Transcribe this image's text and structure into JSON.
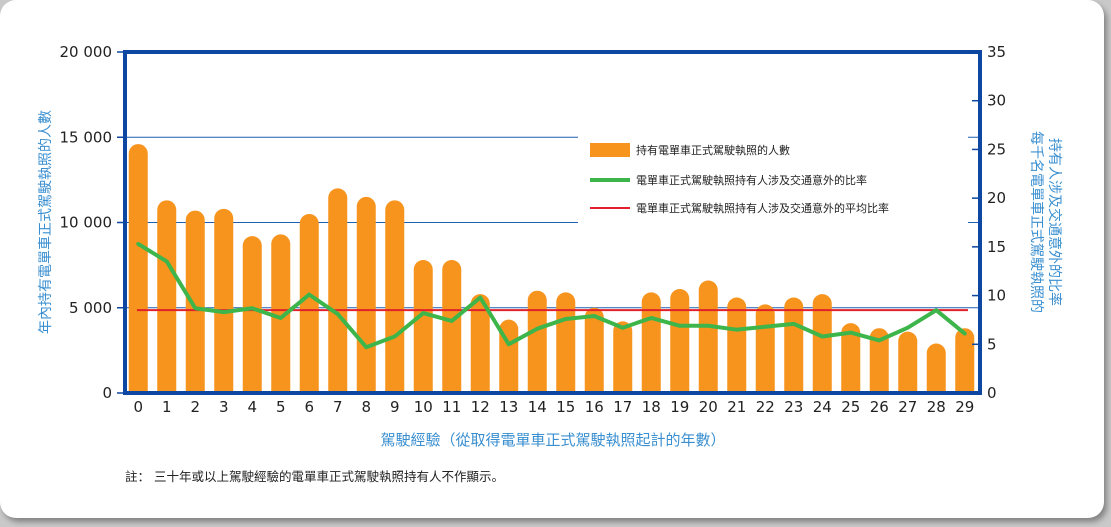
{
  "chart_data": {
    "type": "bar",
    "categories": [
      "0",
      "1",
      "2",
      "3",
      "4",
      "5",
      "6",
      "7",
      "8",
      "9",
      "10",
      "11",
      "12",
      "13",
      "14",
      "15",
      "16",
      "17",
      "18",
      "19",
      "20",
      "21",
      "22",
      "23",
      "24",
      "25",
      "26",
      "27",
      "28",
      "29"
    ],
    "series": [
      {
        "name": "持有電單車正式駕駛執照的人數",
        "type": "bar",
        "axis": "left",
        "values": [
          14600,
          11300,
          10700,
          10800,
          9200,
          9300,
          10500,
          12000,
          11500,
          11300,
          7800,
          7800,
          5800,
          4300,
          6000,
          5900,
          5000,
          4200,
          5900,
          6100,
          6600,
          5600,
          5200,
          5600,
          5800,
          4100,
          3800,
          3600,
          2900,
          3800
        ]
      },
      {
        "name": "電單車正式駕駛執照持有人涉及交通意外的比率",
        "type": "line",
        "axis": "right",
        "values": [
          15.3,
          13.5,
          8.7,
          8.3,
          8.7,
          7.7,
          10.1,
          8.1,
          4.7,
          5.8,
          8.2,
          7.4,
          9.8,
          5.0,
          6.6,
          7.6,
          7.9,
          6.7,
          7.7,
          6.9,
          6.9,
          6.5,
          6.8,
          7.1,
          5.8,
          6.2,
          5.4,
          6.7,
          8.5,
          6.1
        ]
      },
      {
        "name": "電單車正式駕駛執照持有人涉及交通意外的平均比率",
        "type": "line",
        "axis": "right",
        "values": [
          8.5
        ]
      }
    ],
    "xlabel": "駕駛經驗（從取得電單車正式駕駛執照起計的年數）",
    "ylabel": "年內持有電單車正式駕駛執照的人數",
    "y2label_line1": "每千名電單車正式駕駛執照的",
    "y2label_line2": "持有人涉及交通意外的比率",
    "ylim": [
      0,
      20000
    ],
    "y2lim": [
      0,
      35
    ],
    "yticks": [
      "0",
      "5 000",
      "10 000",
      "15 000",
      "20 000"
    ],
    "y2ticks": [
      "0",
      "5",
      "10",
      "15",
      "20",
      "25",
      "30",
      "35"
    ],
    "legend_position": "upper-right",
    "grid": "horizontal at left-axis major ticks",
    "colors": {
      "bar": "#f7941d",
      "line": "#3db54a",
      "average": "#e2202c",
      "axis": "#0d47a1",
      "grid": "#1f5fb0",
      "label": "#3a8fd0"
    }
  },
  "note": "註：  三十年或以上駕駛經驗的電單車正式駕駛執照持有人不作顯示。"
}
